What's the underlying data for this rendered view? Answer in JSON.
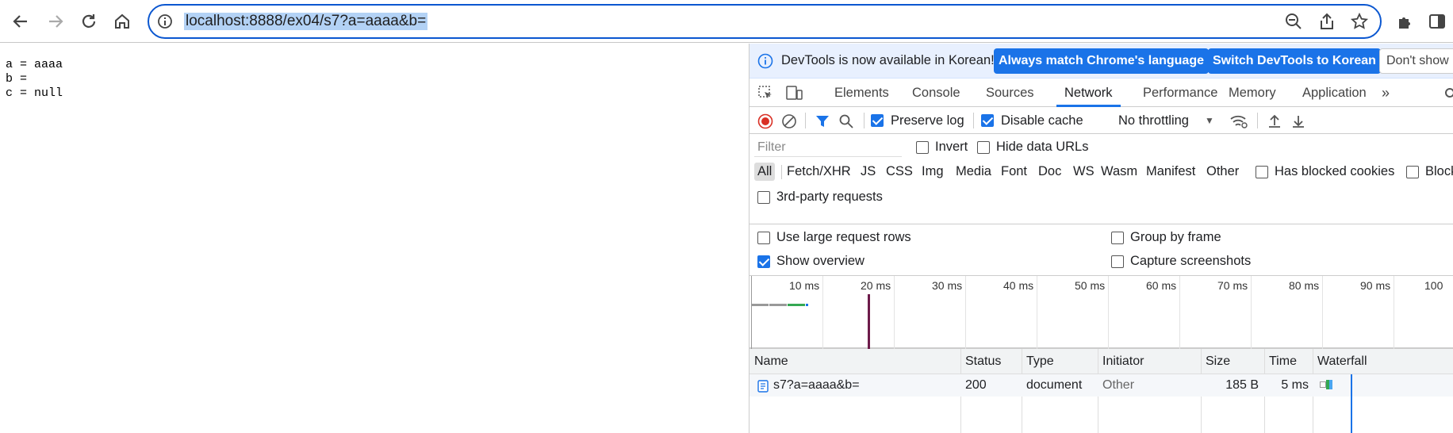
{
  "browser": {
    "url": "localhost:8888/ex04/s7?a=aaaa&b=",
    "icons": [
      "back-arrow-icon",
      "forward-arrow-icon",
      "reload-icon",
      "home-icon",
      "site-info-icon",
      "zoom-out-icon",
      "share-icon",
      "bookmark-star-icon",
      "extensions-icon",
      "side-panel-icon"
    ]
  },
  "page": {
    "lines": [
      "a = aaaa",
      "b =",
      "c = null"
    ]
  },
  "devtools": {
    "infobar": {
      "message": "DevTools is now available in Korean!",
      "btn_match": "Always match Chrome's language",
      "btn_switch": "Switch DevTools to Korean",
      "btn_dont": "Don't show"
    },
    "tabs": [
      "Elements",
      "Console",
      "Sources",
      "Network",
      "Performance",
      "Memory",
      "Application"
    ],
    "active_tab": "Network",
    "controls": {
      "preserve_log": "Preserve log",
      "preserve_log_checked": true,
      "disable_cache": "Disable cache",
      "disable_cache_checked": true,
      "throttling": "No throttling"
    },
    "filter": {
      "placeholder": "Filter",
      "invert": "Invert",
      "hide_data_urls": "Hide data URLs",
      "types": [
        "All",
        "Fetch/XHR",
        "JS",
        "CSS",
        "Img",
        "Media",
        "Font",
        "Doc",
        "WS",
        "Wasm",
        "Manifest",
        "Other"
      ],
      "active_type": "All",
      "has_blocked_cookies": "Has blocked cookies",
      "blocked": "Block",
      "third_party": "3rd-party requests"
    },
    "settings": {
      "large_rows": "Use large request rows",
      "group_by_frame": "Group by frame",
      "show_overview": "Show overview",
      "show_overview_checked": true,
      "capture_screenshots": "Capture screenshots"
    },
    "overview_ticks": [
      "10 ms",
      "20 ms",
      "30 ms",
      "40 ms",
      "50 ms",
      "60 ms",
      "70 ms",
      "80 ms",
      "90 ms",
      "100"
    ],
    "table": {
      "headers": [
        "Name",
        "Status",
        "Type",
        "Initiator",
        "Size",
        "Time",
        "Waterfall"
      ],
      "rows": [
        {
          "name": "s7?a=aaaa&b=",
          "status": "200",
          "type": "document",
          "initiator": "Other",
          "size": "185 B",
          "time": "5 ms"
        }
      ]
    },
    "colors": {
      "accent": "#1a73e8",
      "record": "#d93025",
      "dom_line": "#6d1b4a"
    }
  }
}
